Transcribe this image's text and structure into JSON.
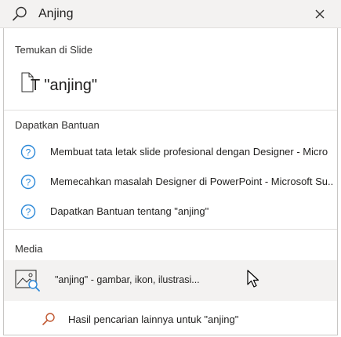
{
  "search": {
    "value": "Anjing",
    "icon": "search-icon",
    "clear_icon": "close-icon"
  },
  "find": {
    "title": "Temukan di Slide",
    "result": "\"anjing\"",
    "icon": "text-document-icon"
  },
  "help": {
    "title": "Dapatkan Bantuan",
    "items": [
      {
        "label": "Membuat tata letak slide profesional dengan Designer - Micro",
        "icon": "help-circle-icon"
      },
      {
        "label": "Memecahkan masalah Designer di PowerPoint - Microsoft Su...",
        "icon": "help-circle-icon"
      },
      {
        "label": "Dapatkan Bantuan tentang \"anjing\"",
        "icon": "help-circle-icon"
      }
    ]
  },
  "media": {
    "title": "Media",
    "result": "\"anjing\" - gambar, ikon, ilustrasi...",
    "icon": "image-search-icon"
  },
  "more": {
    "label": "Hasil pencarian lainnya untuk \"anjing\"",
    "icon": "search-icon"
  },
  "colors": {
    "accent": "#2b88d8",
    "search_accent": "#c0562f",
    "hover": "#f3f2f1"
  }
}
